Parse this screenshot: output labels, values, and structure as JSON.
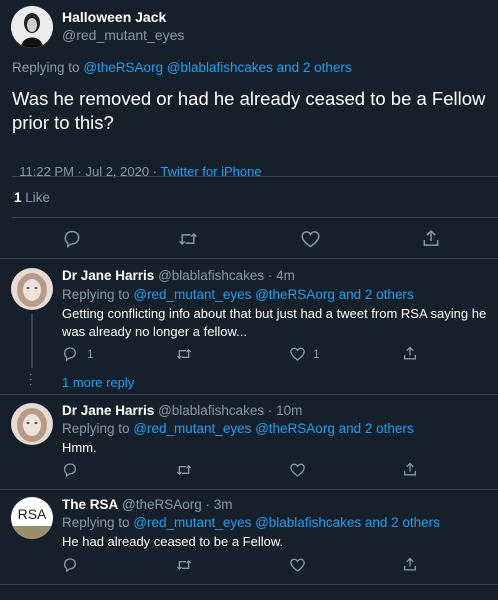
{
  "main_tweet": {
    "author_name": "Halloween Jack",
    "handle": "@red_mutant_eyes",
    "replying_prefix": "Replying to",
    "replying_mentions": "@theRSAorg @blablafishcakes and 2 others",
    "text_line1": "Was he removed or had he already ceased to be a Fellow",
    "text_line2": "prior to this?",
    "timestamp": "11:22 PM · Jul 2, 2020 · ",
    "source": "Twitter for iPhone",
    "like_count": "1",
    "like_label": "Like"
  },
  "replies": [
    {
      "author_name": "Dr Jane Harris",
      "handle_time": "@blablafishcakes · 4m",
      "replying_prefix": "Replying to",
      "replying_mentions": "@red_mutant_eyes @theRSAorg and 2 others",
      "text_line1": "Getting conflicting info about that but just had a tweet from RSA saying he",
      "text_line2": "was already no longer a fellow...",
      "reply_count": "1",
      "like_count": "1",
      "more_replies": "1 more reply"
    },
    {
      "author_name": "Dr Jane Harris",
      "handle_time": "@blablafishcakes · 10m",
      "replying_prefix": "Replying to",
      "replying_mentions": "@red_mutant_eyes @theRSAorg and 2 others",
      "text_line1": "Hmm."
    },
    {
      "author_name": "The RSA",
      "handle_time": "@theRSAorg · 3m",
      "replying_prefix": "Replying to",
      "replying_mentions": "@red_mutant_eyes @blablafishcakes and 2 others",
      "text_line1": "He had already ceased to be a Fellow.",
      "avatar_text": "RSA"
    }
  ],
  "icons": [
    "reply-icon",
    "retweet-icon",
    "like-icon",
    "share-icon"
  ],
  "colors": {
    "background": "#15202b",
    "link": "#1da1f2",
    "muted": "#8899a6",
    "divider": "#38444d"
  }
}
